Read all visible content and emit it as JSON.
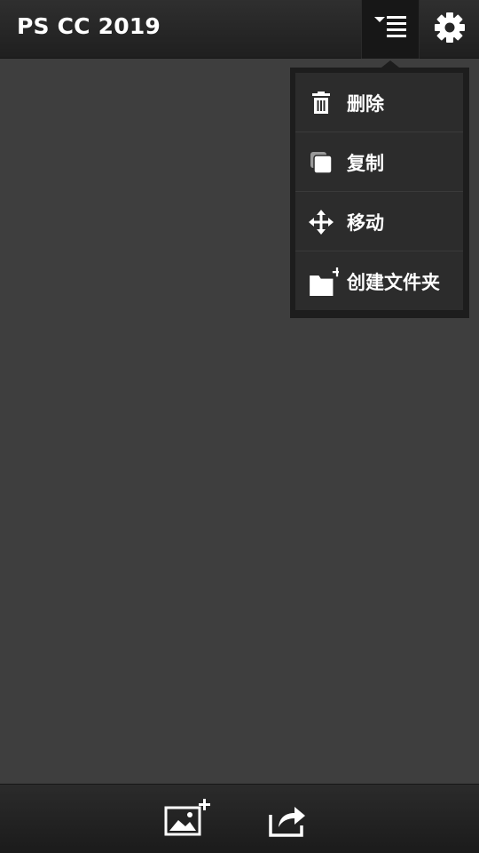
{
  "app_bar": {
    "title": "PS CC 2019",
    "menu_icon": "sort-list-icon",
    "settings_icon": "gear-icon"
  },
  "dropdown_menu": {
    "items": [
      {
        "label": "删除",
        "icon": "trash-icon"
      },
      {
        "label": "复制",
        "icon": "copy-icon"
      },
      {
        "label": "移动",
        "icon": "move-arrows-icon"
      },
      {
        "label": "创建文件夹",
        "icon": "new-folder-icon"
      }
    ]
  },
  "bottom_bar": {
    "add_image_icon": "add-image-icon",
    "share_icon": "share-icon"
  },
  "colors": {
    "background": "#3e3e3e",
    "bar": "#242424",
    "menu_item": "#2c2c2c",
    "text": "#ffffff"
  }
}
